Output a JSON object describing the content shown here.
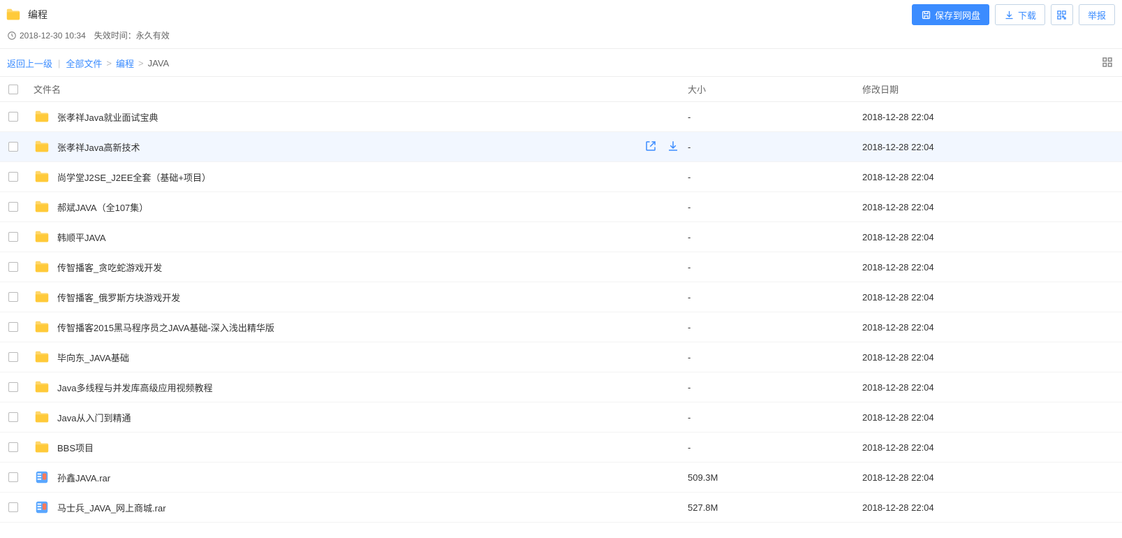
{
  "header": {
    "title": "编程",
    "buttons": {
      "save": "保存到网盘",
      "download": "下载",
      "report": "举报"
    }
  },
  "meta": {
    "timestamp": "2018-12-30 10:34",
    "expire_label": "失效时间：永久有效"
  },
  "breadcrumb": {
    "back": "返回上一级",
    "all": "全部文件",
    "parent": "编程",
    "current": "JAVA"
  },
  "columns": {
    "name": "文件名",
    "size": "大小",
    "date": "修改日期"
  },
  "files": [
    {
      "type": "folder",
      "name": "张孝祥Java就业面试宝典",
      "size": "-",
      "date": "2018-12-28 22:04",
      "hovered": false
    },
    {
      "type": "folder",
      "name": "张孝祥Java高新技术",
      "size": "-",
      "date": "2018-12-28 22:04",
      "hovered": true
    },
    {
      "type": "folder",
      "name": "尚学堂J2SE_J2EE全套（基础+项目）",
      "size": "-",
      "date": "2018-12-28 22:04",
      "hovered": false
    },
    {
      "type": "folder",
      "name": "郝斌JAVA（全107集）",
      "size": "-",
      "date": "2018-12-28 22:04",
      "hovered": false
    },
    {
      "type": "folder",
      "name": "韩顺平JAVA",
      "size": "-",
      "date": "2018-12-28 22:04",
      "hovered": false
    },
    {
      "type": "folder",
      "name": "传智播客_贪吃蛇游戏开发",
      "size": "-",
      "date": "2018-12-28 22:04",
      "hovered": false
    },
    {
      "type": "folder",
      "name": "传智播客_俄罗斯方块游戏开发",
      "size": "-",
      "date": "2018-12-28 22:04",
      "hovered": false
    },
    {
      "type": "folder",
      "name": "传智播客2015黑马程序员之JAVA基础-深入浅出精华版",
      "size": "-",
      "date": "2018-12-28 22:04",
      "hovered": false
    },
    {
      "type": "folder",
      "name": "毕向东_JAVA基础",
      "size": "-",
      "date": "2018-12-28 22:04",
      "hovered": false
    },
    {
      "type": "folder",
      "name": "Java多线程与并发库高级应用视频教程",
      "size": "-",
      "date": "2018-12-28 22:04",
      "hovered": false
    },
    {
      "type": "folder",
      "name": "Java从入门到精通",
      "size": "-",
      "date": "2018-12-28 22:04",
      "hovered": false
    },
    {
      "type": "folder",
      "name": "BBS项目",
      "size": "-",
      "date": "2018-12-28 22:04",
      "hovered": false
    },
    {
      "type": "rar",
      "name": "孙鑫JAVA.rar",
      "size": "509.3M",
      "date": "2018-12-28 22:04",
      "hovered": false
    },
    {
      "type": "rar",
      "name": "马士兵_JAVA_网上商城.rar",
      "size": "527.8M",
      "date": "2018-12-28 22:04",
      "hovered": false
    }
  ]
}
